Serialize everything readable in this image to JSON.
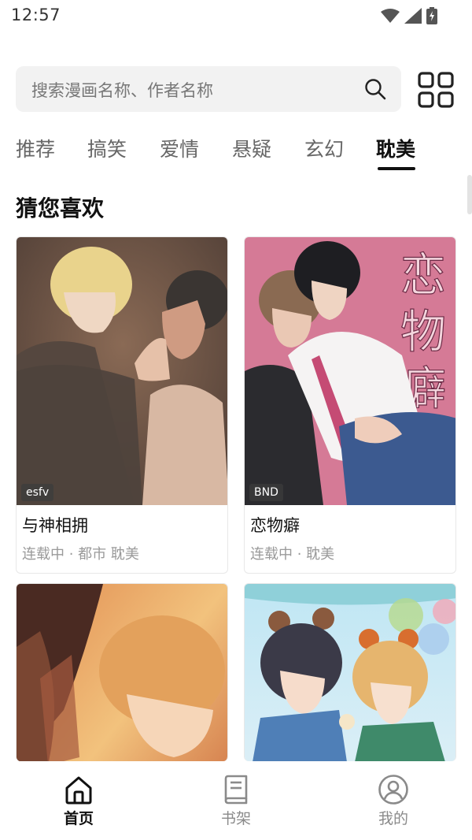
{
  "status_bar": {
    "time": "12:57"
  },
  "search": {
    "placeholder": "搜索漫画名称、作者名称"
  },
  "tabs": [
    {
      "label": "推荐"
    },
    {
      "label": "搞笑"
    },
    {
      "label": "爱情"
    },
    {
      "label": "悬疑"
    },
    {
      "label": "玄幻"
    },
    {
      "label": "耽美",
      "active": true
    }
  ],
  "section": {
    "title": "猜您喜欢"
  },
  "cards": [
    {
      "title": "与神相拥",
      "meta": "连载中 · 都市 耽美",
      "tag": "esfv"
    },
    {
      "title": "恋物癖",
      "meta": "连载中 · 耽美",
      "tag": "BND"
    },
    {
      "title": "",
      "meta": "",
      "tag": ""
    },
    {
      "title": "",
      "meta": "",
      "tag": ""
    }
  ],
  "cover_lettering": {
    "card2": [
      "恋",
      "物",
      "癖"
    ]
  },
  "bottom_nav": [
    {
      "label": "首页",
      "icon": "home-icon",
      "active": true
    },
    {
      "label": "书架",
      "icon": "bookshelf-icon"
    },
    {
      "label": "我的",
      "icon": "profile-icon"
    }
  ],
  "colors": {
    "text": "#111111",
    "muted": "#8a8a8a",
    "search_bg": "#f2f2f2",
    "cover2_bg": "#d57a96"
  }
}
